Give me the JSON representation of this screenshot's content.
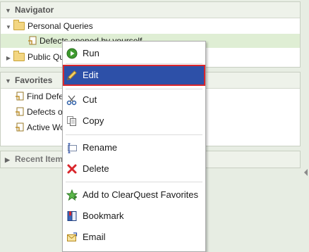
{
  "navigator": {
    "title": "Navigator",
    "items": [
      {
        "label": "Personal Queries"
      },
      {
        "label": "Defects opened by yourself"
      },
      {
        "label": "Public Queries"
      }
    ]
  },
  "favorites": {
    "title": "Favorites",
    "items": [
      {
        "label": "Find Defects"
      },
      {
        "label": "Defects opened by yourself"
      },
      {
        "label": "Active Work"
      }
    ]
  },
  "recent": {
    "title": "Recent Items"
  },
  "context_menu": {
    "items": [
      {
        "label": "Run",
        "icon": "run-icon"
      },
      {
        "label": "Edit",
        "icon": "pencil-icon",
        "selected": true
      },
      {
        "label": "Cut",
        "icon": "scissors-icon"
      },
      {
        "label": "Copy",
        "icon": "copy-icon"
      },
      {
        "label": "Rename",
        "icon": "rename-icon"
      },
      {
        "label": "Delete",
        "icon": "delete-icon"
      },
      {
        "label": "Add to ClearQuest Favorites",
        "icon": "star-icon"
      },
      {
        "label": "Bookmark",
        "icon": "bookmark-icon"
      },
      {
        "label": "Email",
        "icon": "email-icon"
      }
    ]
  },
  "colors": {
    "selected_bg": "#2d50a8",
    "highlight_border": "#d9262c",
    "pane_bg": "#e7ede3"
  }
}
